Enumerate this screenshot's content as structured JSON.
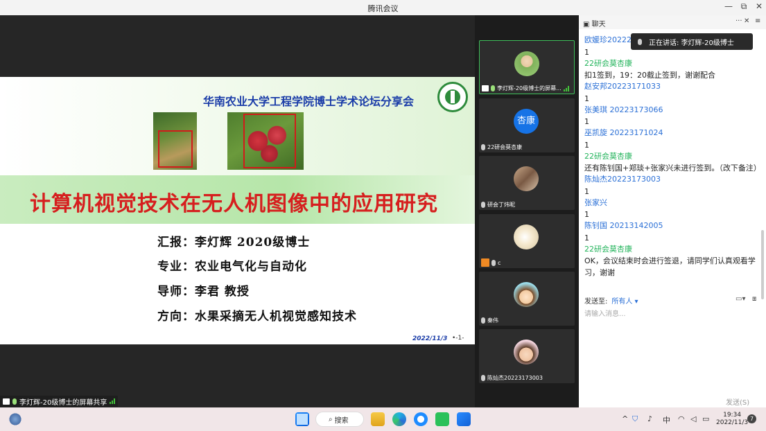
{
  "window": {
    "title": "腾讯会议",
    "minimize": "—",
    "restore": "⧉",
    "close": "✕"
  },
  "slide": {
    "subtitle": "华南农业大学工程学院博士学术论坛分享会",
    "title": "计算机视觉技术在无人机图像中的应用研究",
    "reporter": "汇报：李灯辉  2020级博士",
    "major": "专业：农业电气化与自动化",
    "advisor": "导师：李君  教授",
    "direction": "方向：水果采摘无人机视觉感知技术",
    "date": "2022/11/3",
    "page": "•-1-"
  },
  "share_badge": "李灯辉-20级博士的屏幕共享",
  "participants": [
    {
      "name": "李灯辉-20级博士的屏幕...",
      "avatar_text": ""
    },
    {
      "name": "22研会莫杏康",
      "avatar_text": "杏康"
    },
    {
      "name": "研会丁炜昵",
      "avatar_text": ""
    },
    {
      "name": "c",
      "avatar_text": ""
    },
    {
      "name": "秦伟",
      "avatar_text": ""
    },
    {
      "name": "陈灿杰20223173003",
      "avatar_text": ""
    }
  ],
  "chat": {
    "header": "聊天",
    "more": "···",
    "close": "✕",
    "menu": "≡",
    "speaking": "正在讲话: 李灯辉-20级博士",
    "messages": [
      {
        "name": "欧媛珍2022217",
        "text": "1",
        "color": "blue"
      },
      {
        "name": "22研会莫杏康",
        "text": "扣1签到，19：20截止签到，谢谢配合",
        "color": "green"
      },
      {
        "name": "赵安邦20223171033",
        "text": "1",
        "color": "blue"
      },
      {
        "name": "张美琪 20223173066",
        "text": "1",
        "color": "blue"
      },
      {
        "name": "巫凯旋 20223171024",
        "text": "1",
        "color": "blue"
      },
      {
        "name": "22研会莫杏康",
        "text": "还有陈钊国+郑琰+张家兴未进行签到。（改下备注）",
        "color": "green"
      },
      {
        "name": "陈灿杰20223173003",
        "text": "1",
        "color": "blue"
      },
      {
        "name": "张家兴",
        "text": "1",
        "color": "blue"
      },
      {
        "name": "陈钊国 20213142005",
        "text": "1",
        "color": "blue"
      },
      {
        "name": "22研会莫杏康",
        "text": "OK，会议结束时会进行签退，请同学们认真观看学习，谢谢",
        "color": "green"
      }
    ],
    "send_to_label": "发送至:",
    "send_to_value": "所有人",
    "input_placeholder": "请输入消息...",
    "send_button": "发送(S)"
  },
  "taskbar": {
    "search": "搜索",
    "ime": "中",
    "time": "19:34",
    "date": "2022/11/3",
    "notifications": "7"
  },
  "colors": {
    "accent_green": "#21b35a",
    "accent_blue": "#2a6fd6",
    "title_red": "#d61e1e"
  }
}
